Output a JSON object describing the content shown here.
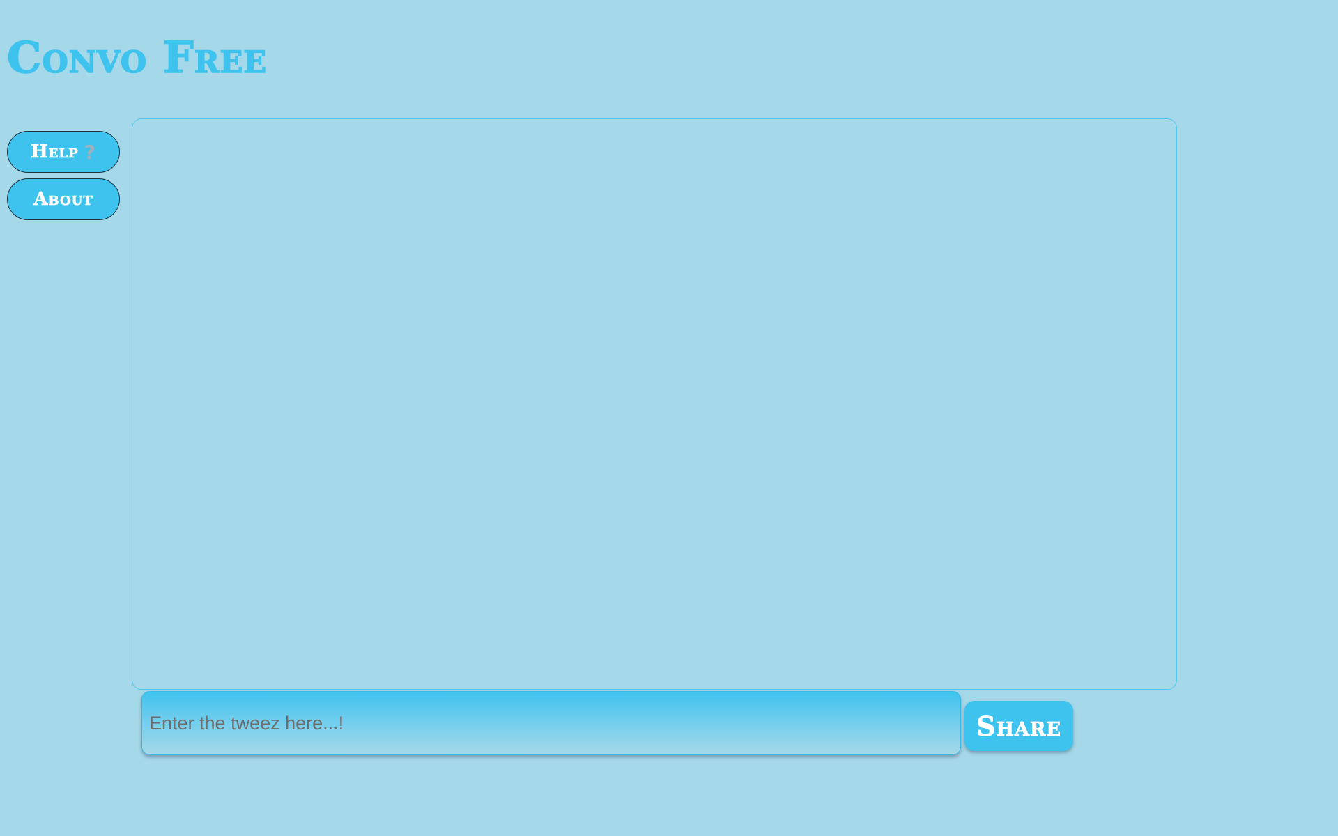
{
  "app": {
    "title": "Convo Free",
    "colors": {
      "background": "#a5d8e8",
      "accent": "#3ec3ef",
      "button_text": "#ffffff"
    }
  },
  "sidebar": {
    "help_label": "Help",
    "help_icon": "question-mark-icon",
    "help_icon_glyph": "?",
    "about_label": "About"
  },
  "composer": {
    "placeholder": "Enter the tweez here...!",
    "value": "",
    "share_label": "Share"
  }
}
